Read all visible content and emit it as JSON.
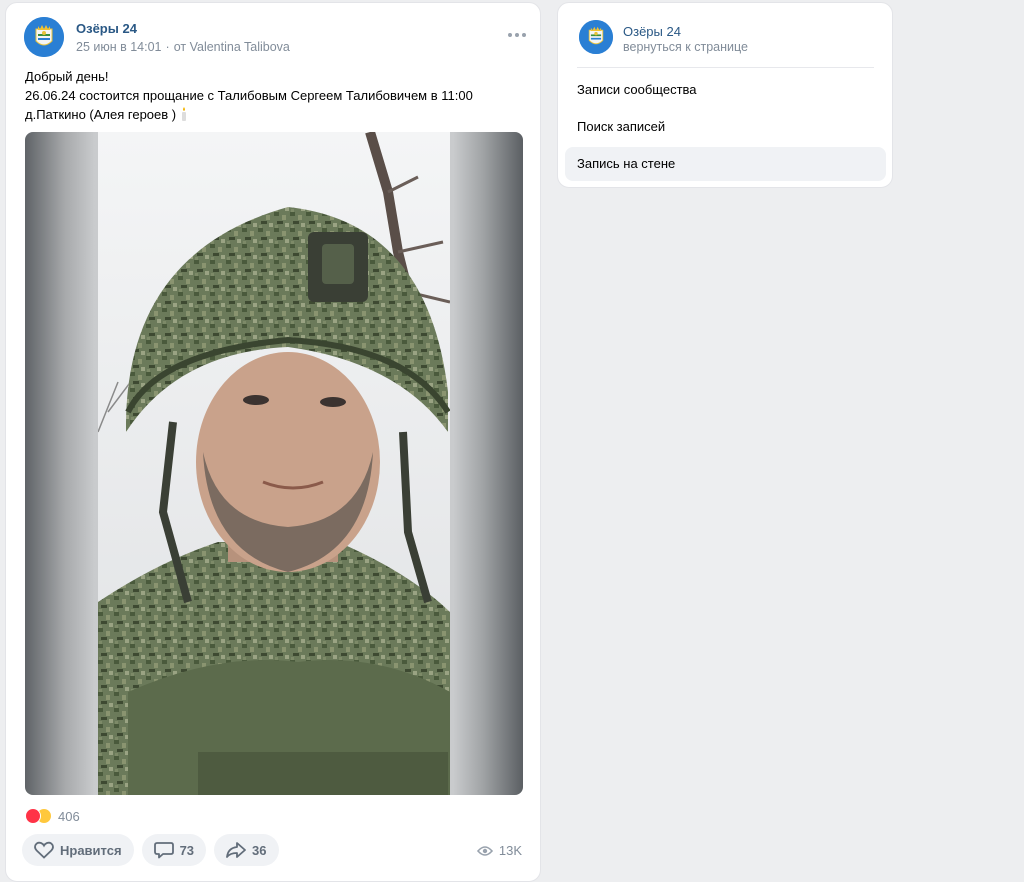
{
  "post": {
    "group_name": "Озёры 24",
    "date": "25 июн в 14:01",
    "author_prefix": "от",
    "author": "Valentina Talibova",
    "more_icon": "more-horizontal-icon",
    "text_lines": [
      "Добрый день!",
      "26.06.24 состоится прощание с Талибовым Сергеем Талибовичем в 11:00",
      "д.Паткино (Алея героев )"
    ],
    "reactions_count": "406",
    "actions": {
      "like_label": "Нравится",
      "comments_count": "73",
      "shares_count": "36"
    },
    "views": "13K"
  },
  "sidebar": {
    "group_name": "Озёры 24",
    "back_label": "вернуться к странице",
    "items": [
      {
        "label": "Записи сообщества",
        "active": false
      },
      {
        "label": "Поиск записей",
        "active": false
      },
      {
        "label": "Запись на стене",
        "active": true
      }
    ]
  },
  "colors": {
    "link": "#2a5885",
    "muted": "#818c99",
    "button_bg": "#f0f2f5",
    "heart": "#ff3347"
  }
}
